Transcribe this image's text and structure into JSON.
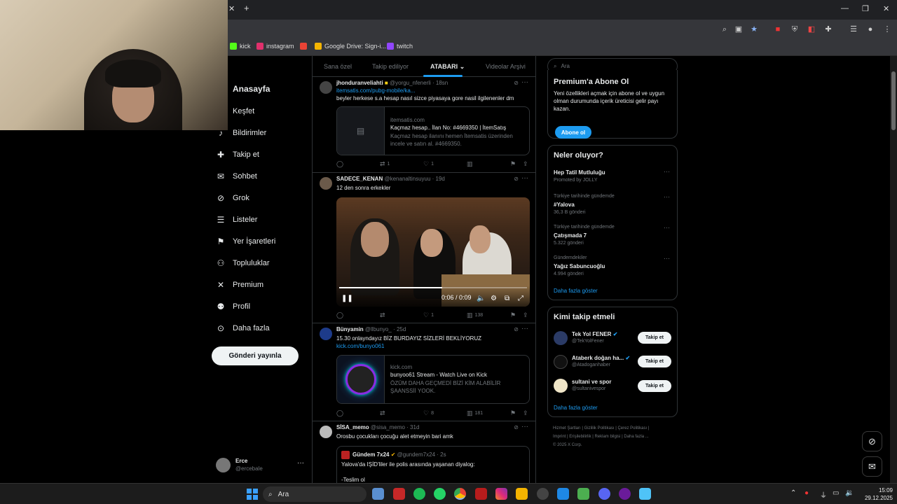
{
  "browser": {
    "bookmarks": [
      {
        "label": "kick",
        "color": "#53fc18"
      },
      {
        "label": "instagram",
        "color": "#e1306c"
      },
      {
        "label": "",
        "color": "#ea4335"
      },
      {
        "label": "Google Drive: Sign-i...",
        "color": "#f4b400"
      },
      {
        "label": "twitch",
        "color": "#9146ff"
      }
    ]
  },
  "nav": {
    "items": [
      {
        "label": "Anasayfa",
        "icon": "home-icon",
        "glyph": "⌂"
      },
      {
        "label": "Keşfet",
        "icon": "search-icon",
        "glyph": "⌕"
      },
      {
        "label": "Bildirimler",
        "icon": "bell-icon",
        "glyph": "🔔"
      },
      {
        "label": "Takip et",
        "icon": "add-user-icon",
        "glyph": "👤"
      },
      {
        "label": "Sohbet",
        "icon": "mail-icon",
        "glyph": "✉"
      },
      {
        "label": "Grok",
        "icon": "grok-icon",
        "glyph": "⊘"
      },
      {
        "label": "Listeler",
        "icon": "list-icon",
        "glyph": "☰"
      },
      {
        "label": "Yer İşaretleri",
        "icon": "bookmark-icon",
        "glyph": "⚑"
      },
      {
        "label": "Topluluklar",
        "icon": "communities-icon",
        "glyph": "👥"
      },
      {
        "label": "Premium",
        "icon": "x-logo-icon",
        "glyph": "𝕏"
      },
      {
        "label": "Profil",
        "icon": "profile-icon",
        "glyph": "👤"
      },
      {
        "label": "Daha fazla",
        "icon": "more-circle-icon",
        "glyph": "⋯"
      }
    ],
    "post_button": "Gönderi yayınla",
    "user": {
      "name": "Erce",
      "handle": "@ercebale"
    }
  },
  "tabs": [
    "Sana özel",
    "Takip ediliyor",
    "ATABARI",
    "Videolar Arşivi"
  ],
  "tweets": [
    {
      "name": "jhonduranveliahti",
      "handle": "@yorgu_nfenerli · 18sn",
      "link": "itemsatis.com/pubg-mobile/ka...",
      "text": "beyler herkese s.a hesap nasıl sizce piyasaya gore nasil ilgilenenler dm",
      "card": {
        "domain": "itemsatis.com",
        "title": "Kaçmaz hesap.. İlan No: #4669350 | İtemSatış",
        "desc": "Kaçmaz hesap ilanını hemen İtemsatis üzerinden incele ve satın al. #4669350."
      },
      "stats": {
        "replies": "",
        "reposts": "1",
        "likes": "1",
        "views": ""
      }
    },
    {
      "name": "SADECE_KENAN",
      "handle": "@kenanaltinsuyuu · 19d",
      "text": "12 den sonra erkekler",
      "video": {
        "time": "0:06 / 0:09",
        "progress": 0.55
      },
      "stats": {
        "replies": "",
        "reposts": "",
        "likes": "1",
        "views": "138"
      }
    },
    {
      "name": "Bünyamin",
      "handle": "@llbunyo_ · 25d",
      "text": "15.30 onlayndayız BİZ BURDAYIZ SİZLERİ BEKLİYORUZ",
      "link": "kick.com/bunyo061",
      "card": {
        "domain": "kick.com",
        "title": "bunyoo61 Stream - Watch Live on Kick",
        "desc": "ÖZÜM DAHA GEÇMEDİ BİZİ KİM ALABİLİR ŞAANSSİİ YOOK."
      },
      "stats": {
        "replies": "",
        "reposts": "",
        "likes": "8",
        "views": "181"
      }
    },
    {
      "name": "SİSA_memo",
      "handle": "@sisa_memo · 31d",
      "text": "Orosbu çocukları çocuğu alet etmeyin bari amk",
      "quote": {
        "name": "Gündem 7x24",
        "handle": "@gundem7x24 · 2s",
        "text": "Yalova'da IŞİD'liler ile polis arasında yaşanan diyalog:",
        "text2": "-Teslim ol"
      }
    }
  ],
  "right": {
    "search_placeholder": "Ara",
    "premium": {
      "title": "Premium'a Abone Ol",
      "text": "Yeni özellikleri açmak için abone ol ve uygun olman durumunda içerik üreticisi gelir payı kazan.",
      "button": "Abone ol"
    },
    "trends": {
      "title": "Neler oluyor?",
      "items": [
        {
          "context": "",
          "name": "Hep Tatil Mutluluğu",
          "count": "Promoted by JOLLY"
        },
        {
          "context": "Türkiye tarihinde gündemde",
          "name": "#Yalova",
          "count": "36,3 B gönderi"
        },
        {
          "context": "Türkiye tarihinde gündemde",
          "name": "Çatışmada 7",
          "count": "5.322 gönderi"
        },
        {
          "context": "Gündemdekiler",
          "name": "Yağız Sabuncuoğlu",
          "count": "4.994 gönderi"
        }
      ],
      "more": "Daha fazla göster"
    },
    "who": {
      "title": "Kimi takip etmeli",
      "items": [
        {
          "name": "Tek Yol FENER",
          "handle": "@TekYolFener",
          "button": "Takip et"
        },
        {
          "name": "Ataberk doğan ha...",
          "handle": "@Atadoganhaber",
          "button": "Takip et"
        },
        {
          "name": "sultani ve spor",
          "handle": "@sultanivespor",
          "button": "Takip et"
        }
      ],
      "more": "Daha fazla göster"
    },
    "footer": {
      "line1": "Hizmet Şartları  |  Gizlilik Politikası  |  Çerez Politikası  |",
      "line2": "Imprint  |  Erişilebilirlik  |  Reklam bilgisi  |  Daha fazla ...",
      "line3": "© 2025 X Corp."
    }
  },
  "taskbar": {
    "search": "Ara",
    "time": "15:09",
    "date": "29.12.2025"
  }
}
